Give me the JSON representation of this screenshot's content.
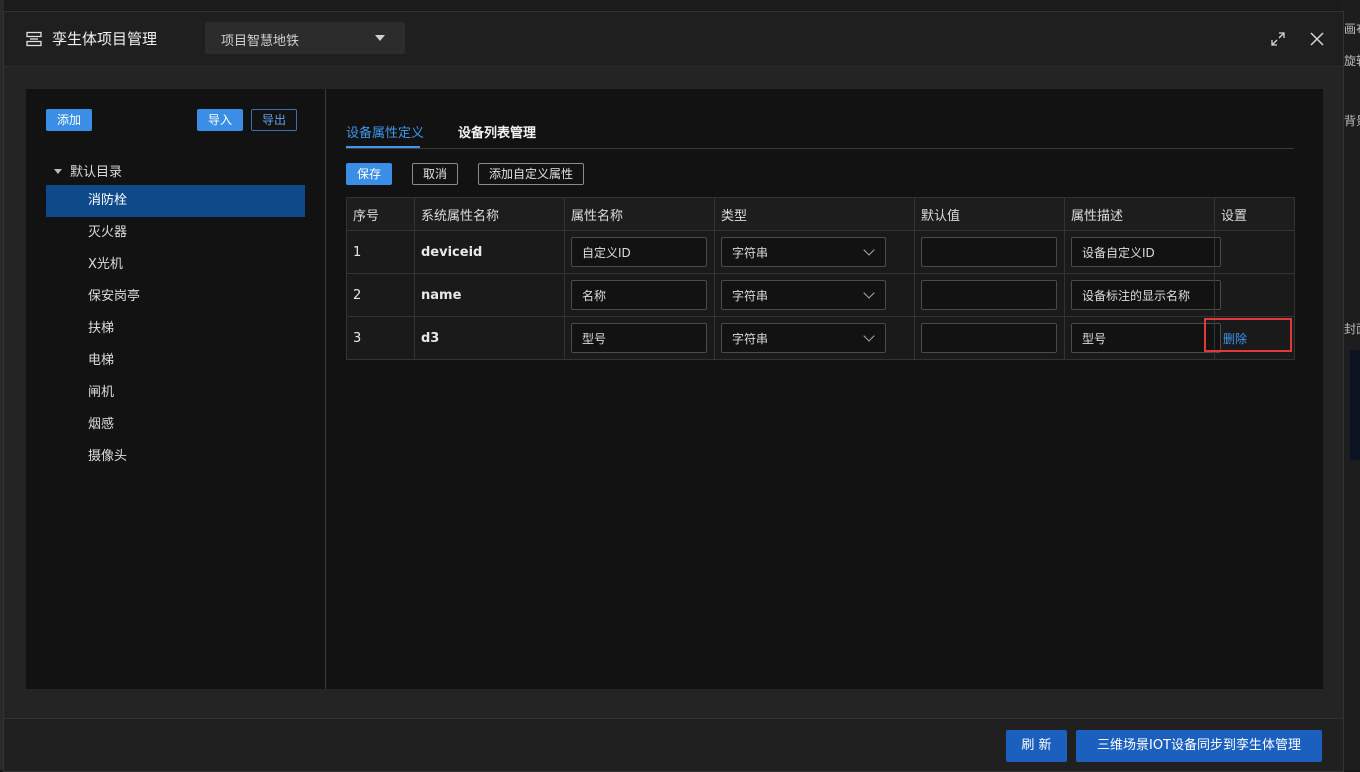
{
  "background": {
    "right_fragments": [
      "画布",
      "旋转",
      "背景",
      "封面"
    ]
  },
  "header": {
    "icon": "server-list-icon",
    "title": "孪生体项目管理",
    "project_select": {
      "value": "项目智慧地铁",
      "icon": "caret-down-icon"
    },
    "maximize_icon": "maximize-icon",
    "close_icon": "close-icon"
  },
  "sidebar": {
    "add_label": "添加",
    "import_label": "导入",
    "export_label": "导出",
    "root_label": "默认目录",
    "items": [
      {
        "label": "消防栓",
        "active": true
      },
      {
        "label": "灭火器"
      },
      {
        "label": "X光机"
      },
      {
        "label": "保安岗亭"
      },
      {
        "label": "扶梯"
      },
      {
        "label": "电梯"
      },
      {
        "label": "闸机"
      },
      {
        "label": "烟感"
      },
      {
        "label": "摄像头"
      }
    ]
  },
  "main": {
    "tabs": [
      {
        "label": "设备属性定义",
        "active": true
      },
      {
        "label": "设备列表管理"
      }
    ],
    "toolbar": {
      "save_label": "保存",
      "cancel_label": "取消",
      "add_custom_label": "添加自定义属性"
    },
    "table": {
      "columns": [
        "序号",
        "系统属性名称",
        "属性名称",
        "类型",
        "默认值",
        "属性描述",
        "设置"
      ],
      "rows": [
        {
          "index": "1",
          "system_name": "deviceid",
          "name": "自定义ID",
          "type": "字符串",
          "default": "",
          "description": "设备自定义ID",
          "action": ""
        },
        {
          "index": "2",
          "system_name": "name",
          "name": "名称",
          "type": "字符串",
          "default": "",
          "description": "设备标注的显示名称",
          "action": ""
        },
        {
          "index": "3",
          "system_name": "d3",
          "name": "型号",
          "type": "字符串",
          "default": "",
          "description": "型号",
          "action": "删除"
        }
      ]
    }
  },
  "footer": {
    "refresh_label": "刷 新",
    "sync_label": "三维场景IOT设备同步到孪生体管理"
  },
  "colors": {
    "accent": "#3a8ee6",
    "active_row": "#0e4a8a",
    "highlight": "#e03a3a"
  }
}
